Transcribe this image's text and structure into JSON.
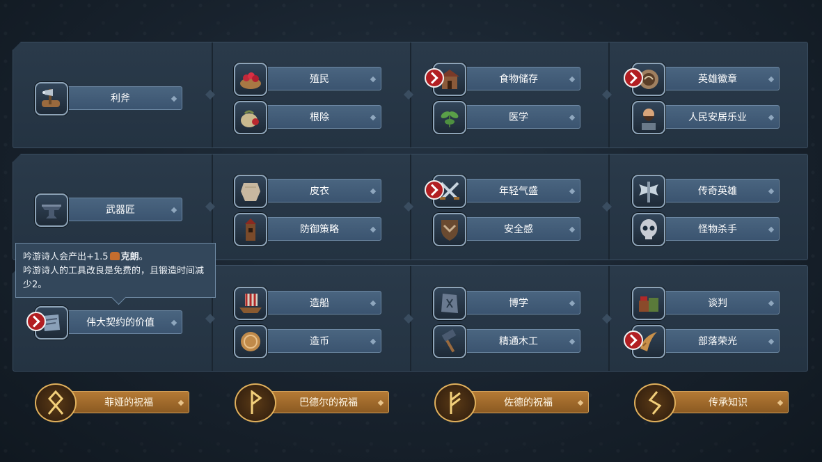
{
  "rows": [
    {
      "cells": [
        {
          "label": "利斧",
          "icon": "axe-log-icon"
        },
        {
          "label": "殖民",
          "icon": "berry-bowl-icon"
        },
        {
          "label": "根除",
          "icon": "root-bag-icon"
        },
        {
          "label": "食物储存",
          "icon": "storehouse-icon",
          "warning": true
        },
        {
          "label": "医学",
          "icon": "herb-icon"
        },
        {
          "label": "英雄徽章",
          "icon": "hero-badge-icon",
          "warning": true
        },
        {
          "label": "人民安居乐业",
          "icon": "bearded-man-icon"
        }
      ]
    },
    {
      "cells": [
        {
          "label": "武器匠",
          "icon": "anvil-icon"
        },
        {
          "label": "皮衣",
          "icon": "leather-hide-icon"
        },
        {
          "label": "防御策略",
          "icon": "watchtower-icon"
        },
        {
          "label": "年轻气盛",
          "icon": "crossed-swords-icon",
          "warning": true
        },
        {
          "label": "安全感",
          "icon": "shield-chevron-icon"
        },
        {
          "label": "传奇英雄",
          "icon": "double-axe-icon"
        },
        {
          "label": "怪物杀手",
          "icon": "skull-icon"
        }
      ]
    },
    {
      "cells": [
        {
          "label": "伟大契约的价值",
          "icon": "contract-scroll-icon",
          "warning": true
        },
        {
          "label": "造船",
          "icon": "longship-icon"
        },
        {
          "label": "造币",
          "icon": "coin-icon"
        },
        {
          "label": "博学",
          "icon": "rune-stone-icon"
        },
        {
          "label": "精通木工",
          "icon": "woodwork-hammer-icon"
        },
        {
          "label": "谈判",
          "icon": "trade-goods-icon"
        },
        {
          "label": "部落荣光",
          "icon": "horn-icon",
          "warning": true
        }
      ]
    }
  ],
  "tooltip": {
    "line1_prefix": "吟游诗人会产出+1.5",
    "line1_currency": "克朗",
    "line1_suffix": "。",
    "line2": "吟游诗人的工具改良是免费的，且锻造时间减少2。"
  },
  "blessings": [
    {
      "label": "菲娅的祝福",
      "rune": "ᛟ",
      "icon": "othala-rune-icon"
    },
    {
      "label": "巴德尔的祝福",
      "rune": "ᚹ",
      "icon": "wunjo-rune-icon"
    },
    {
      "label": "佐德的祝福",
      "rune": "ᚠ",
      "icon": "fehu-rune-icon"
    },
    {
      "label": "传承知识",
      "rune": "ᛊ",
      "icon": "sowilo-rune-icon"
    }
  ],
  "colors": {
    "panel": "#2a3a4a",
    "bar": "#4a6580",
    "warning": "#b21e22",
    "gold": "#e0b05c"
  }
}
